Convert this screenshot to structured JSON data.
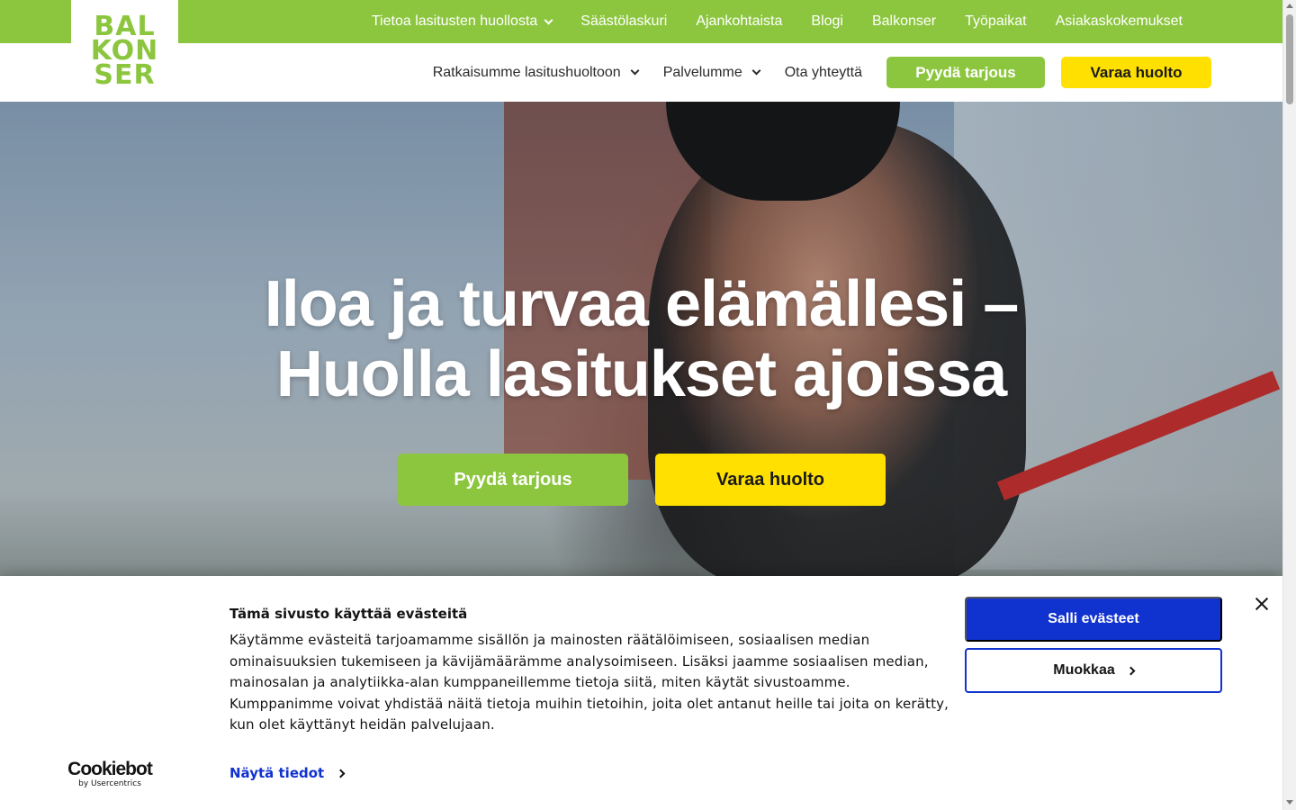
{
  "logo": {
    "line1": "BAL",
    "line2": "KON",
    "line3": "SER"
  },
  "topbar": {
    "items": [
      {
        "label": "Tietoa lasitusten huollosta",
        "has_dropdown": true
      },
      {
        "label": "Säästölaskuri"
      },
      {
        "label": "Ajankohtaista"
      },
      {
        "label": "Blogi"
      },
      {
        "label": "Balkonser"
      },
      {
        "label": "Työpaikat"
      },
      {
        "label": "Asiakaskokemukset"
      }
    ]
  },
  "mainnav": {
    "items": [
      {
        "label": "Ratkaisumme lasitushuoltoon",
        "has_dropdown": true
      },
      {
        "label": "Palvelumme",
        "has_dropdown": true
      },
      {
        "label": "Ota yhteyttä"
      }
    ],
    "quote_button": "Pyydä tarjous",
    "service_button": "Varaa huolto"
  },
  "hero": {
    "title_line1": "Iloa ja turvaa elämällesi –",
    "title_line2": "Huolla lasitukset ajoissa",
    "quote_button": "Pyydä tarjous",
    "service_button": "Varaa huolto"
  },
  "cookie_banner": {
    "title": "Tämä sivusto käyttää evästeitä",
    "body": "Käytämme evästeitä tarjoamamme sisällön ja mainosten räätälöimiseen, sosiaalisen median ominaisuuksien tukemiseen ja kävijämäärämme analysoimiseen. Lisäksi jaamme sosiaalisen median, mainosalan ja analytiikka-alan kumppaneillemme tietoja siitä, miten käytät sivustoamme. Kumppanimme voivat yhdistää näitä tietoja muihin tietoihin, joita olet antanut heille tai joita on kerätty, kun olet käyttänyt heidän palvelujaan.",
    "details_link": "Näytä tiedot",
    "allow_button": "Salli evästeet",
    "customize_button": "Muokkaa",
    "brand": "Cookiebot",
    "brand_sub": "by Usercentrics"
  },
  "colors": {
    "brand_green": "#8cc63f",
    "brand_yellow": "#ffe000",
    "cookie_blue": "#1032cf"
  },
  "icons": [
    "chevron-down-icon",
    "chevron-right-icon",
    "close-icon"
  ]
}
